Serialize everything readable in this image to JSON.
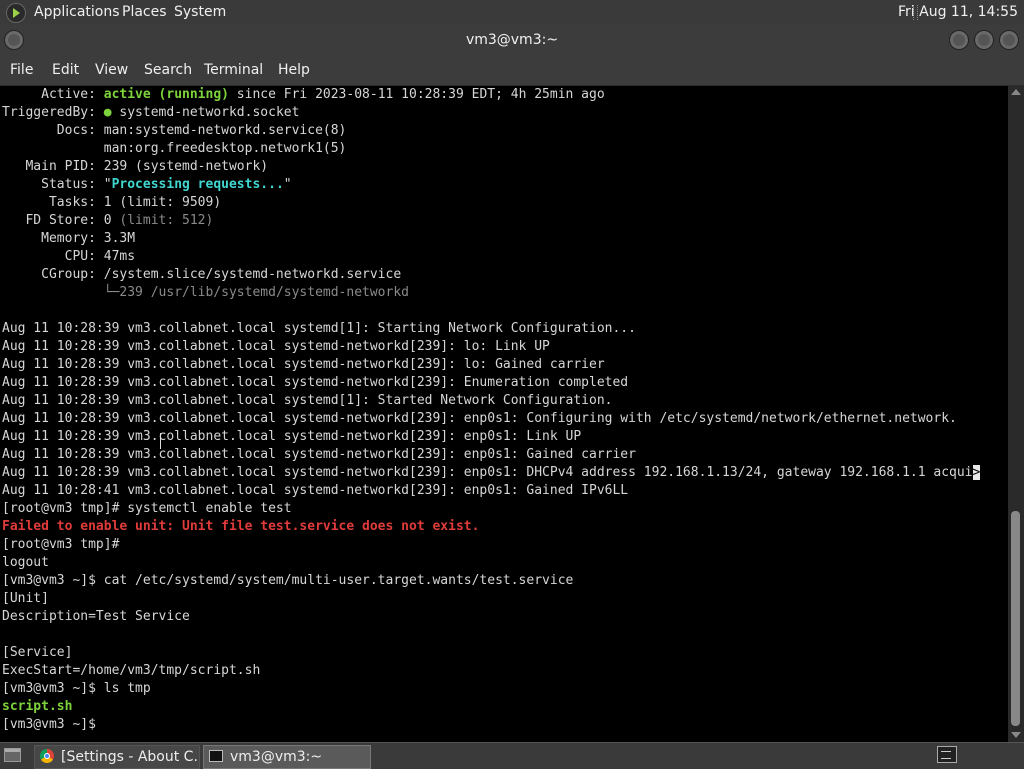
{
  "top_panel": {
    "menus": [
      "Applications",
      "Places",
      "System"
    ],
    "clock": "Fri Aug 11, 14:55",
    "apps_icon": "distro-logo-icon"
  },
  "window": {
    "title": "vm3@vm3:~",
    "buttons": [
      "minimize-icon",
      "maximize-icon",
      "close-icon"
    ]
  },
  "menubar": [
    "File",
    "Edit",
    "View",
    "Search",
    "Terminal",
    "Help"
  ],
  "terminal": {
    "lines": [
      [
        {
          "t": "     Active: "
        },
        {
          "t": "active (running)",
          "c": "g"
        },
        {
          "t": " since Fri 2023-08-11 10:28:39 EDT; 4h 25min ago"
        }
      ],
      [
        {
          "t": "TriggeredBy: "
        },
        {
          "t": "●",
          "c": "g"
        },
        {
          "t": " systemd-networkd.socket"
        }
      ],
      [
        {
          "t": "       Docs: man:systemd-networkd.service(8)"
        }
      ],
      [
        {
          "t": "             man:org.freedesktop.network1(5)"
        }
      ],
      [
        {
          "t": "   Main PID: 239 (systemd-network)"
        }
      ],
      [
        {
          "t": "     Status: \""
        },
        {
          "t": "Processing requests...",
          "c": "c"
        },
        {
          "t": "\""
        }
      ],
      [
        {
          "t": "      Tasks: 1 (limit: 9509)"
        }
      ],
      [
        {
          "t": "   FD Store: 0 "
        },
        {
          "t": "(limit: 512)",
          "c": "dim"
        }
      ],
      [
        {
          "t": "     Memory: 3.3M"
        }
      ],
      [
        {
          "t": "        CPU: 47ms"
        }
      ],
      [
        {
          "t": "     CGroup: /system.slice/systemd-networkd.service"
        }
      ],
      [
        {
          "t": "             └─",
          "c": "dim"
        },
        {
          "t": "239 /usr/lib/systemd/systemd-networkd",
          "c": "dim"
        }
      ],
      [
        {
          "t": ""
        }
      ],
      [
        {
          "t": "Aug 11 10:28:39 vm3.collabnet.local systemd[1]: Starting Network Configuration..."
        }
      ],
      [
        {
          "t": "Aug 11 10:28:39 vm3.collabnet.local systemd-networkd[239]: lo: Link UP"
        }
      ],
      [
        {
          "t": "Aug 11 10:28:39 vm3.collabnet.local systemd-networkd[239]: lo: Gained carrier"
        }
      ],
      [
        {
          "t": "Aug 11 10:28:39 vm3.collabnet.local systemd-networkd[239]: Enumeration completed"
        }
      ],
      [
        {
          "t": "Aug 11 10:28:39 vm3.collabnet.local systemd[1]: Started Network Configuration."
        }
      ],
      [
        {
          "t": "Aug 11 10:28:39 vm3.collabnet.local systemd-networkd[239]: enp0s1: Configuring with /etc/systemd/network/ethernet.network."
        }
      ],
      [
        {
          "t": "Aug 11 10:28:39 vm3.collabnet.local systemd-networkd[239]: enp0s1: Link UP"
        }
      ],
      [
        {
          "t": "Aug 11 10:28:39 vm3.collabnet.local systemd-networkd[239]: enp0s1: Gained carrier"
        }
      ],
      [
        {
          "t": "Aug 11 10:28:39 vm3.collabnet.local systemd-networkd[239]: enp0s1: DHCPv4 address 192.168.1.13/24, gateway 192.168.1.1 acqui"
        },
        {
          "t": ">",
          "c": "cursor-block"
        }
      ],
      [
        {
          "t": "Aug 11 10:28:41 vm3.collabnet.local systemd-networkd[239]: enp0s1: Gained IPv6LL"
        }
      ],
      [
        {
          "t": "[root@vm3 tmp]# systemctl enable test"
        }
      ],
      [
        {
          "t": "Failed to enable unit: Unit file test.service does not exist.",
          "c": "r"
        }
      ],
      [
        {
          "t": "[root@vm3 tmp]#"
        }
      ],
      [
        {
          "t": "logout"
        }
      ],
      [
        {
          "t": "[vm3@vm3 ~]$ cat /etc/systemd/system/multi-user.target.wants/test.service"
        }
      ],
      [
        {
          "t": "[Unit]"
        }
      ],
      [
        {
          "t": "Description=Test Service"
        }
      ],
      [
        {
          "t": ""
        }
      ],
      [
        {
          "t": "[Service]"
        }
      ],
      [
        {
          "t": "ExecStart=/home/vm3/tmp/script.sh"
        }
      ],
      [
        {
          "t": "[vm3@vm3 ~]$ ls tmp"
        }
      ],
      [
        {
          "t": "script.sh",
          "c": "g"
        }
      ],
      [
        {
          "t": "[vm3@vm3 ~]$"
        }
      ]
    ]
  },
  "taskbar": {
    "tasks": [
      {
        "label": "[Settings - About C...",
        "icon": "chrome-icon"
      },
      {
        "label": "vm3@vm3:~",
        "icon": "terminal-icon"
      }
    ]
  }
}
